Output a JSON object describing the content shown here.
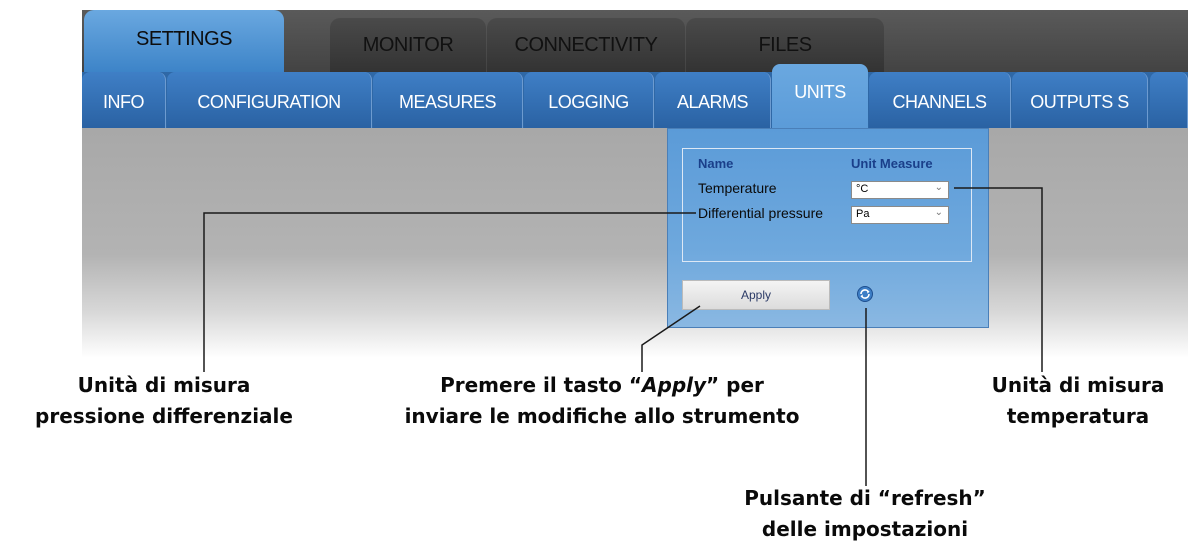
{
  "top_tabs": [
    {
      "label": "SETTINGS",
      "active": true
    },
    {
      "label": "MONITOR",
      "active": false
    },
    {
      "label": "CONNECTIVITY",
      "active": false
    },
    {
      "label": "FILES",
      "active": false
    }
  ],
  "sub_tabs": [
    {
      "label": "INFO",
      "active": false
    },
    {
      "label": "CONFIGURATION",
      "active": false
    },
    {
      "label": "MEASURES",
      "active": false
    },
    {
      "label": "LOGGING",
      "active": false
    },
    {
      "label": "ALARMS",
      "active": false
    },
    {
      "label": "UNITS",
      "active": true
    },
    {
      "label": "CHANNELS",
      "active": false
    },
    {
      "label": "OUTPUTS S",
      "active": false
    }
  ],
  "units_panel": {
    "header_name": "Name",
    "header_unit": "Unit Measure",
    "rows": [
      {
        "name": "Temperature",
        "unit": "°C"
      },
      {
        "name": "Differential pressure",
        "unit": "Pa"
      }
    ],
    "apply_label": "Apply",
    "refresh_icon": "refresh-icon"
  },
  "annotations": {
    "diff_pressure": {
      "line1": "Unità di misura",
      "line2": "pressione differenziale"
    },
    "apply": {
      "line1_pre": "Premere il tasto “",
      "line1_em": "Apply",
      "line1_post": "” per",
      "line2": "inviare le modifiche allo strumento"
    },
    "temperature": {
      "line1": "Unità di misura",
      "line2": "temperatura"
    },
    "refresh": {
      "line1": "Pulsante di “refresh”",
      "line2": "delle impostazioni"
    }
  },
  "colors": {
    "active_tab": "#5b9bd8",
    "sub_tab_bg": "#2f68a6",
    "top_tab_bg": "#3a3a3a",
    "panel_header_text": "#1a3f8a"
  }
}
